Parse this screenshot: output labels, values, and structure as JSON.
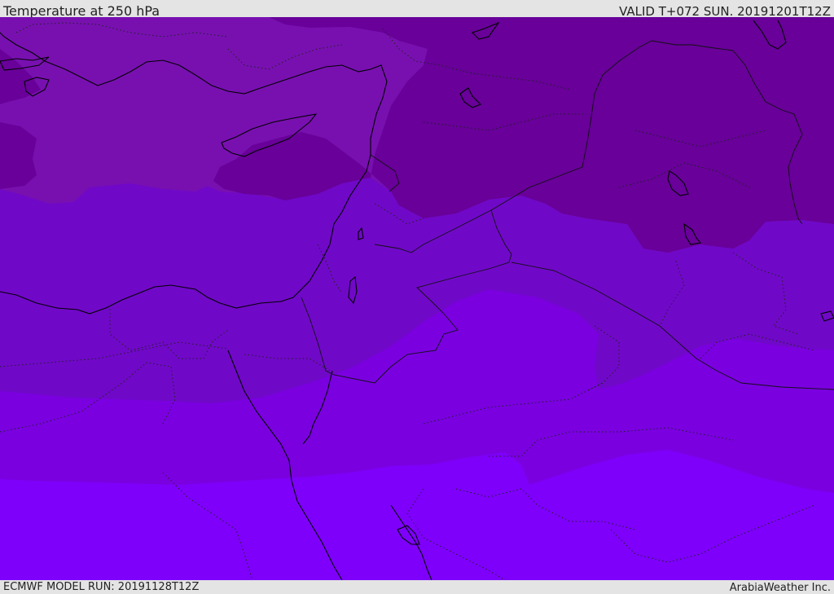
{
  "header": {
    "title": "Temperature at 250 hPa",
    "valid": "VALID T+072 SUN. 20191201T12Z"
  },
  "footer": {
    "model_run": "ECMWF MODEL RUN: 20191128T12Z",
    "credit": "ArabiaWeather Inc."
  },
  "map": {
    "temperature_bands": [
      {
        "color": "#680099"
      },
      {
        "color": "#7810b0"
      },
      {
        "color": "#7008c8"
      },
      {
        "color": "#7a00e0"
      },
      {
        "color": "#7e00fa"
      }
    ],
    "coastline_color": "#000000",
    "border_style": "dotted"
  }
}
